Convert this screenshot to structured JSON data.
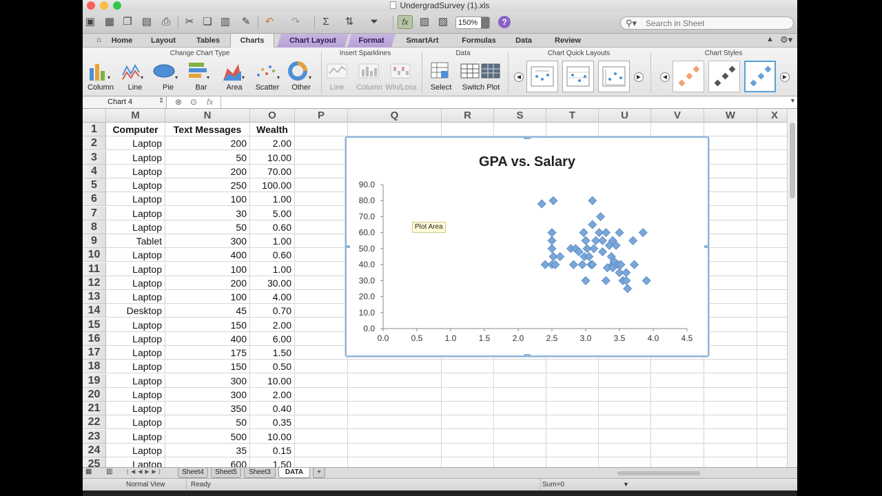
{
  "window": {
    "title": "UndergradSurvey (1).xls",
    "traffic_lights": {
      "close": "#fc605b",
      "minimize": "#fdbc40",
      "zoom": "#34c84a"
    }
  },
  "toolbar": {
    "zoom_value": "150%",
    "search_placeholder": "Search in Sheet"
  },
  "ribbon_tabs": [
    "Home",
    "Layout",
    "Tables",
    "Charts",
    "Chart Layout",
    "Format",
    "SmartArt",
    "Formulas",
    "Data",
    "Review"
  ],
  "ribbon": {
    "groups": {
      "change_chart_type": "Change Chart Type",
      "insert_sparklines": "Insert Sparklines",
      "data": "Data",
      "chart_quick_layouts": "Chart Quick Layouts",
      "chart_styles": "Chart Styles"
    },
    "chart_types": [
      "Column",
      "Line",
      "Pie",
      "Bar",
      "Area",
      "Scatter",
      "Other"
    ],
    "sparklines": [
      "Line",
      "Column",
      "Win/Loss"
    ],
    "data_buttons": [
      "Select",
      "Switch Plot"
    ],
    "style_colors": {
      "orange": "#f0a06e",
      "gray": "#555555",
      "blue": "#6a9fd8"
    }
  },
  "formula_bar": {
    "name_box": "Chart 4",
    "fx": "fx"
  },
  "columns": [
    "M",
    "N",
    "O",
    "P",
    "Q",
    "R",
    "S",
    "T",
    "U",
    "V",
    "W",
    "X"
  ],
  "sheet": {
    "headers": [
      "Computer",
      "Text Messages",
      "Wealth"
    ],
    "rows": [
      [
        "1",
        "",
        "",
        ""
      ],
      [
        "2",
        "Laptop",
        "200",
        "2.00"
      ],
      [
        "3",
        "Laptop",
        "50",
        "10.00"
      ],
      [
        "4",
        "Laptop",
        "200",
        "70.00"
      ],
      [
        "5",
        "Laptop",
        "250",
        "100.00"
      ],
      [
        "6",
        "Laptop",
        "100",
        "1.00"
      ],
      [
        "7",
        "Laptop",
        "30",
        "5.00"
      ],
      [
        "8",
        "Laptop",
        "50",
        "0.60"
      ],
      [
        "9",
        "Tablet",
        "300",
        "1.00"
      ],
      [
        "10",
        "Laptop",
        "400",
        "0.60"
      ],
      [
        "11",
        "Laptop",
        "100",
        "1.00"
      ],
      [
        "12",
        "Laptop",
        "200",
        "30.00"
      ],
      [
        "13",
        "Laptop",
        "100",
        "4.00"
      ],
      [
        "14",
        "Desktop",
        "45",
        "0.70"
      ],
      [
        "15",
        "Laptop",
        "150",
        "2.00"
      ],
      [
        "16",
        "Laptop",
        "400",
        "6.00"
      ],
      [
        "17",
        "Laptop",
        "175",
        "1.50"
      ],
      [
        "18",
        "Laptop",
        "150",
        "0.50"
      ],
      [
        "19",
        "Laptop",
        "300",
        "10.00"
      ],
      [
        "20",
        "Laptop",
        "300",
        "2.00"
      ],
      [
        "21",
        "Laptop",
        "350",
        "0.40"
      ],
      [
        "22",
        "Laptop",
        "50",
        "0.35"
      ],
      [
        "23",
        "Laptop",
        "500",
        "10.00"
      ],
      [
        "24",
        "Laptop",
        "35",
        "0.15"
      ],
      [
        "25",
        "Laptop",
        "600",
        "1.50"
      ]
    ]
  },
  "tooltip": "Plot Area",
  "sheet_tabs": [
    "Sheet4",
    "Sheet5",
    "Sheet3",
    "DATA"
  ],
  "status": {
    "view": "Normal View",
    "state": "Ready",
    "sum": "Sum=0"
  },
  "chart_data": {
    "type": "scatter",
    "title": "GPA vs. Salary",
    "xlabel": "",
    "ylabel": "",
    "xlim": [
      0,
      4.5
    ],
    "ylim": [
      0,
      90
    ],
    "x_ticks": [
      "0.0",
      "0.5",
      "1.0",
      "1.5",
      "2.0",
      "2.5",
      "3.0",
      "3.5",
      "4.0",
      "4.5"
    ],
    "y_ticks": [
      "0.0",
      "10.0",
      "20.0",
      "30.0",
      "40.0",
      "50.0",
      "60.0",
      "70.0",
      "80.0",
      "90.0"
    ],
    "grid": false,
    "marker_color": "#7aa7d9",
    "points": [
      [
        2.35,
        78
      ],
      [
        2.52,
        80
      ],
      [
        3.1,
        80
      ],
      [
        3.22,
        70
      ],
      [
        3.1,
        65
      ],
      [
        2.5,
        60
      ],
      [
        2.5,
        55
      ],
      [
        2.5,
        50
      ],
      [
        2.4,
        40
      ],
      [
        2.5,
        40
      ],
      [
        2.55,
        40
      ],
      [
        2.52,
        45
      ],
      [
        2.62,
        45
      ],
      [
        2.78,
        50
      ],
      [
        2.85,
        50
      ],
      [
        2.82,
        40
      ],
      [
        2.95,
        40
      ],
      [
        2.9,
        48
      ],
      [
        2.98,
        45
      ],
      [
        2.97,
        60
      ],
      [
        3.0,
        55
      ],
      [
        3.02,
        50
      ],
      [
        3.05,
        45
      ],
      [
        3.08,
        40
      ],
      [
        3.1,
        40
      ],
      [
        3.12,
        50
      ],
      [
        3.15,
        55
      ],
      [
        3.2,
        60
      ],
      [
        3.25,
        55
      ],
      [
        3.3,
        60
      ],
      [
        3.25,
        48
      ],
      [
        3.0,
        30
      ],
      [
        3.35,
        52
      ],
      [
        3.38,
        45
      ],
      [
        3.4,
        55
      ],
      [
        3.45,
        52
      ],
      [
        3.4,
        40
      ],
      [
        3.42,
        42
      ],
      [
        3.48,
        40
      ],
      [
        3.52,
        40
      ],
      [
        3.5,
        35
      ],
      [
        3.55,
        30
      ],
      [
        3.6,
        35
      ],
      [
        3.62,
        25
      ],
      [
        3.5,
        60
      ],
      [
        3.3,
        30
      ],
      [
        3.32,
        38
      ],
      [
        3.4,
        38
      ],
      [
        3.7,
        55
      ],
      [
        3.72,
        40
      ],
      [
        3.85,
        60
      ],
      [
        3.9,
        30
      ],
      [
        3.6,
        30
      ]
    ]
  }
}
